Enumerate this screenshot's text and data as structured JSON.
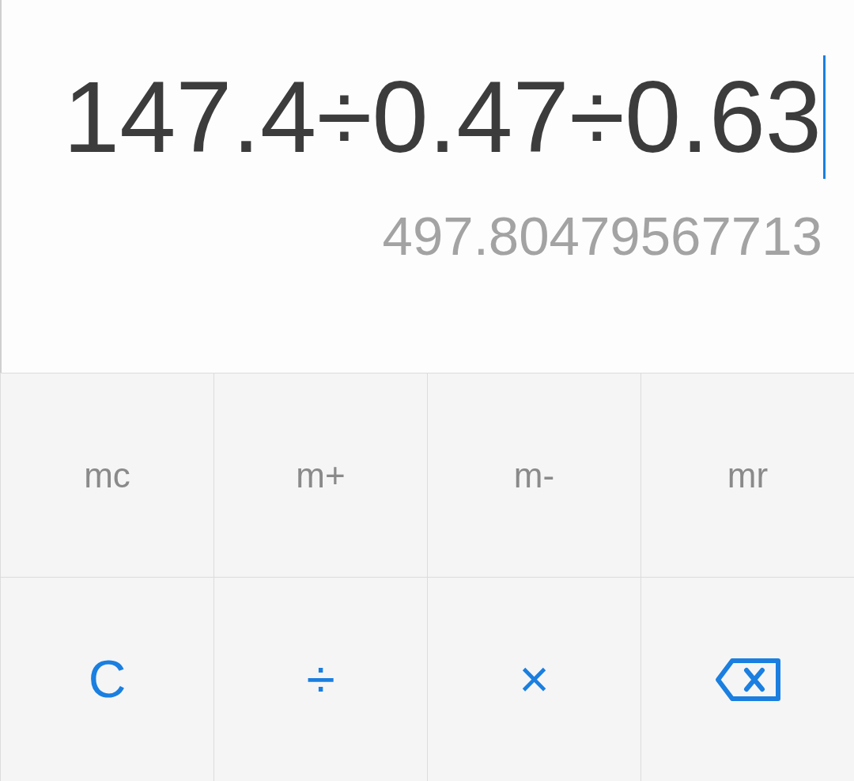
{
  "display": {
    "expression": "147.4÷0.47÷0.63",
    "result": "497.80479567713"
  },
  "keys": [
    {
      "kind": "memory",
      "label": "mc"
    },
    {
      "kind": "memory",
      "label": "m+"
    },
    {
      "kind": "memory",
      "label": "m-"
    },
    {
      "kind": "memory",
      "label": "mr"
    },
    {
      "kind": "operator",
      "label": "C"
    },
    {
      "kind": "operator",
      "label": "÷"
    },
    {
      "kind": "operator",
      "label": "×"
    },
    {
      "kind": "backspace"
    }
  ]
}
